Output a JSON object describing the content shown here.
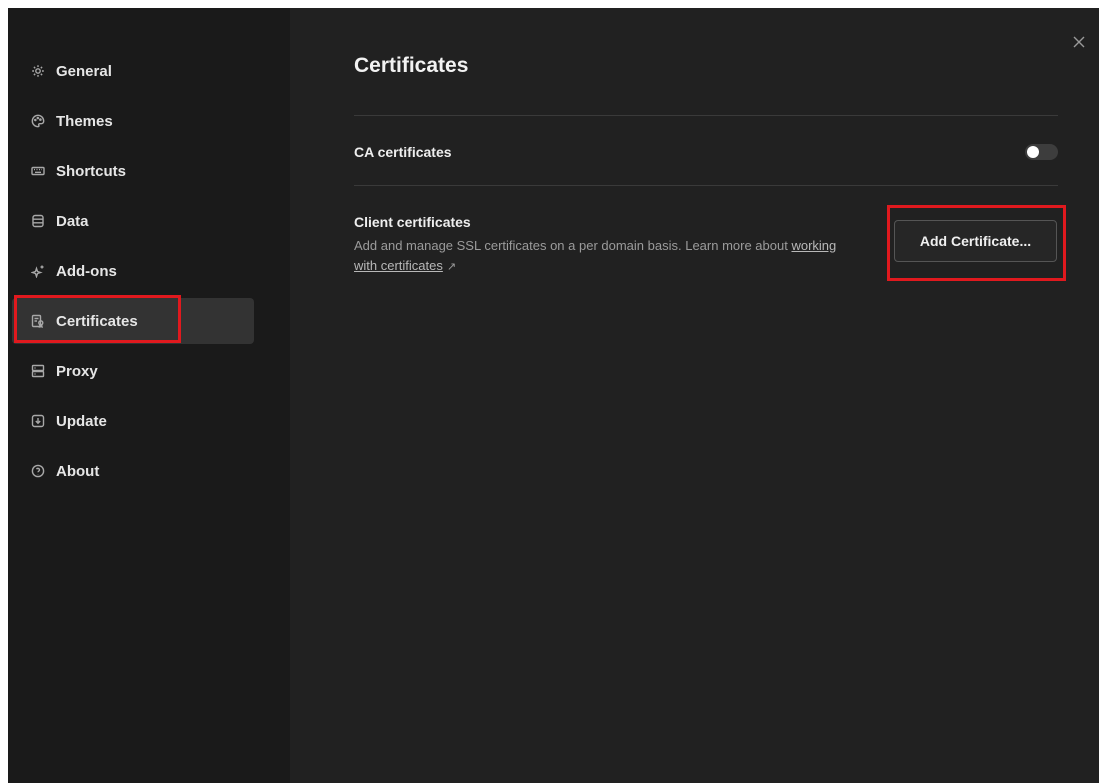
{
  "sidebar": {
    "items": [
      {
        "label": "General",
        "icon": "gear-icon",
        "active": false
      },
      {
        "label": "Themes",
        "icon": "palette-icon",
        "active": false
      },
      {
        "label": "Shortcuts",
        "icon": "keyboard-icon",
        "active": false
      },
      {
        "label": "Data",
        "icon": "database-icon",
        "active": false
      },
      {
        "label": "Add-ons",
        "icon": "sparkle-icon",
        "active": false
      },
      {
        "label": "Certificates",
        "icon": "certificate-icon",
        "active": true
      },
      {
        "label": "Proxy",
        "icon": "server-icon",
        "active": false
      },
      {
        "label": "Update",
        "icon": "download-icon",
        "active": false
      },
      {
        "label": "About",
        "icon": "info-circle-icon",
        "active": false
      }
    ]
  },
  "main": {
    "title": "Certificates",
    "ca_certificates": {
      "label": "CA certificates",
      "enabled": true
    },
    "client_certificates": {
      "label": "Client certificates",
      "description": "Add and manage SSL certificates on a per domain basis. Learn more about",
      "link_text": "working with certificates",
      "link_arrow": "↗",
      "button_label": "Add Certificate..."
    },
    "close_icon": "close-icon"
  },
  "colors": {
    "window_bg": "#212121",
    "sidebar_bg": "#1a1a1a",
    "active_item_bg": "#333333",
    "highlight": "#e0191e",
    "text_primary": "#eeeeee",
    "text_secondary": "#9b9b9b"
  }
}
